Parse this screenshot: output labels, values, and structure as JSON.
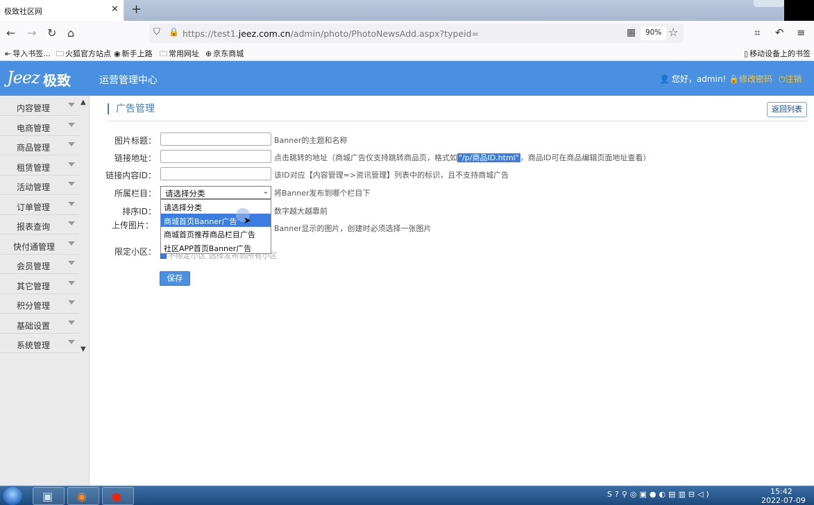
{
  "browser": {
    "tab_title": "极致社区网",
    "tab_close": "✕",
    "tab_new": "+",
    "url_prefix": "https://test1.",
    "url_domain": "jeez.com.cn",
    "url_path": "/admin/photo/PhotoNewsAdd.aspx?typeid=",
    "zoom": "90%",
    "bookmarks": [
      "导入书签...",
      "火狐官方站点",
      "新手上路",
      "常用网址",
      "京东商城"
    ],
    "mobile_bookmarks": "移动设备上的书签"
  },
  "header": {
    "logo": "Jeez",
    "logo_cn": "极致",
    "app_title": "运营管理中心",
    "greeting": "您好，admin!",
    "change_password": "修改密码",
    "logout": "注销"
  },
  "sidebar": {
    "items": [
      "内容管理",
      "电商管理",
      "商品管理",
      "租赁管理",
      "活动管理",
      "订单管理",
      "报表查询",
      "快付通管理",
      "会员管理",
      "其它管理",
      "积分管理",
      "基础设置",
      "系统管理"
    ]
  },
  "page": {
    "title": "广告管理",
    "back_button": "返回列表",
    "fields": {
      "image_title": {
        "label": "图片标题：",
        "value": "",
        "hint": "Banner的主题和名称"
      },
      "link_url": {
        "label": "链接地址：",
        "value": "",
        "hint_before": "点击跳转的地址（商城广告仅支持跳转商品页，格式如",
        "hint_highlight": "\"/p/商品ID.html\"",
        "hint_after": "，商品ID可在商品编辑页面地址查看）"
      },
      "link_content_id": {
        "label": "链接内容ID：",
        "value": "",
        "hint": "该ID对应【内容管理=>资讯管理】列表中的标识，且不支持商城广告"
      },
      "category": {
        "label": "所属栏目：",
        "selected": "请选择分类",
        "hint": "将Banner发布到哪个栏目下"
      },
      "sort_id": {
        "label": "排序ID：",
        "hint": "数字越大越靠前"
      },
      "upload_image": {
        "label": "上传图片：",
        "hint": "Banner显示的图片，创建时必须选择一张图片"
      },
      "limit_community": {
        "label": "限定小区：",
        "text": "不限定小区 选择发布到所有小区"
      }
    },
    "dropdown_options": [
      "请选择分类",
      "商城首页Banner广告",
      "商城首页推荐商品栏目广告",
      "社区APP首页Banner广告"
    ],
    "dropdown_highlighted": 1,
    "save_button": "保存"
  },
  "taskbar": {
    "time": "15:42",
    "date": "2022-07-09"
  },
  "colors": {
    "header_blue": "#4a90e2",
    "accent_yellow": "#f7c531",
    "title_blue": "#3d7fc8",
    "selection_blue": "#3b7de0"
  }
}
